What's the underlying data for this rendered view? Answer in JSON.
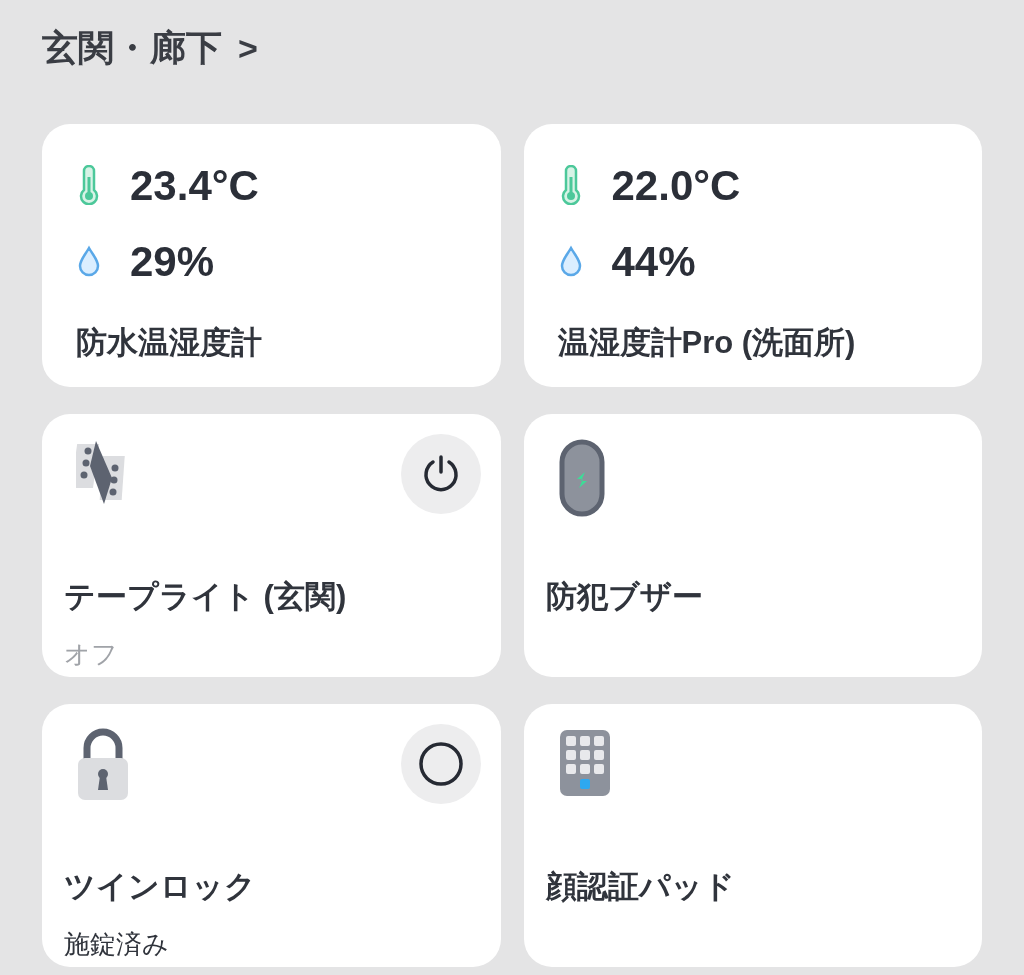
{
  "section": {
    "title": "玄関・廊下",
    "chevron": ">"
  },
  "sensors": [
    {
      "temperature": "23.4°C",
      "humidity": "29%",
      "name": "防水温湿度計"
    },
    {
      "temperature": "22.0°C",
      "humidity": "44%",
      "name": "温湿度計Pro (洗面所)"
    }
  ],
  "devices": [
    {
      "kind": "light",
      "name": "テープライト (玄関)",
      "status": "オフ",
      "button": {
        "kind": "power"
      }
    },
    {
      "kind": "buzzer",
      "name": "防犯ブザー"
    },
    {
      "kind": "lock",
      "name": "ツインロック",
      "status": "施錠済み",
      "button": {
        "kind": "circle"
      }
    },
    {
      "kind": "keypad",
      "name": "顔認証パッド"
    }
  ]
}
